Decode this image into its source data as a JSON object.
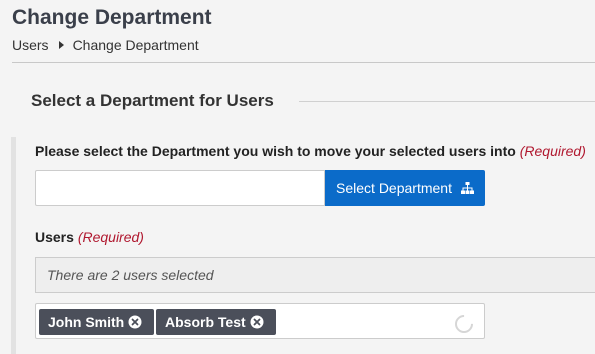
{
  "header": {
    "title": "Change Department",
    "breadcrumb": [
      "Users",
      "Change Department"
    ]
  },
  "section": {
    "legend": "Select a Department for Users"
  },
  "department_field": {
    "label": "Please select the Department you wish to move your selected users into",
    "required": "(Required)",
    "value": "",
    "button_label": "Select Department",
    "button_icon": "sitemap-icon",
    "button_color": "#0b6bc9"
  },
  "users_field": {
    "label": "Users",
    "required": "(Required)",
    "selected_summary": "There are 2 users selected",
    "tags": [
      {
        "label": "John Smith",
        "remove_icon": "close-circle-icon"
      },
      {
        "label": "Absorb Test",
        "remove_icon": "close-circle-icon"
      }
    ],
    "loading_icon": "spinner-icon"
  },
  "colors": {
    "tag_bg": "#4b4f5a",
    "required": "#b0182f"
  }
}
